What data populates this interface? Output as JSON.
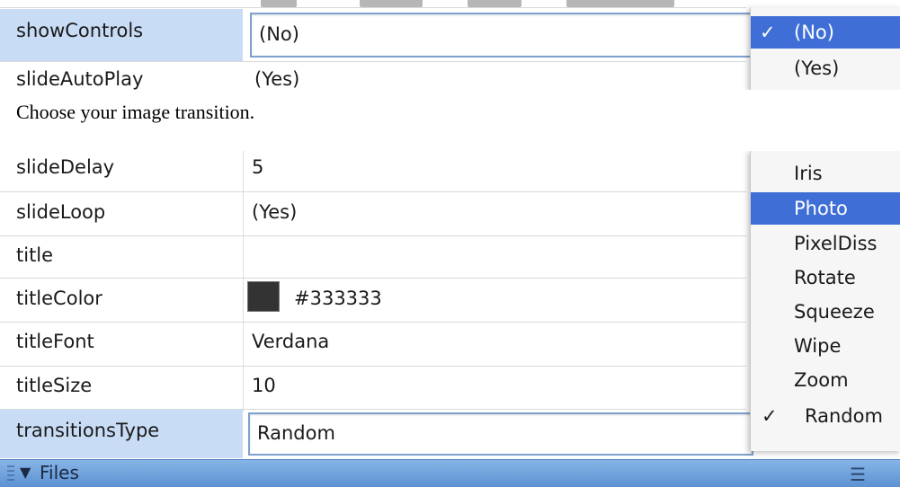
{
  "top_panel": {
    "rows": [
      {
        "name": "showControls",
        "value": "(No)"
      },
      {
        "name": "slideAutoPlay",
        "value": "(Yes)"
      }
    ],
    "popup": {
      "items": [
        {
          "check": "✓",
          "label": "(No)"
        },
        {
          "check": "",
          "label": "(Yes)"
        }
      ]
    }
  },
  "caption": "Choose your image transition.",
  "bottom_panel": {
    "rows": [
      {
        "name": "slideDelay",
        "value": "5"
      },
      {
        "name": "slideLoop",
        "value": "(Yes)"
      },
      {
        "name": "title",
        "value": ""
      },
      {
        "name": "titleColor",
        "value": "#333333",
        "swatch_color": "#333333"
      },
      {
        "name": "titleFont",
        "value": "Verdana"
      },
      {
        "name": "titleSize",
        "value": "10"
      },
      {
        "name": "transitionsType",
        "value": "Random"
      }
    ],
    "popup": {
      "items": [
        {
          "check": "",
          "label": "Iris"
        },
        {
          "check": "",
          "label": "Photo",
          "highlighted": true
        },
        {
          "check": "",
          "label": "PixelDiss"
        },
        {
          "check": "",
          "label": "Rotate"
        },
        {
          "check": "",
          "label": "Squeeze"
        },
        {
          "check": "",
          "label": "Wipe"
        },
        {
          "check": "",
          "label": "Zoom"
        },
        {
          "check": "✓",
          "label": "Random"
        }
      ]
    }
  },
  "files_bar": {
    "arrow": "▼",
    "label": "Files",
    "icon": "list-options-icon"
  }
}
